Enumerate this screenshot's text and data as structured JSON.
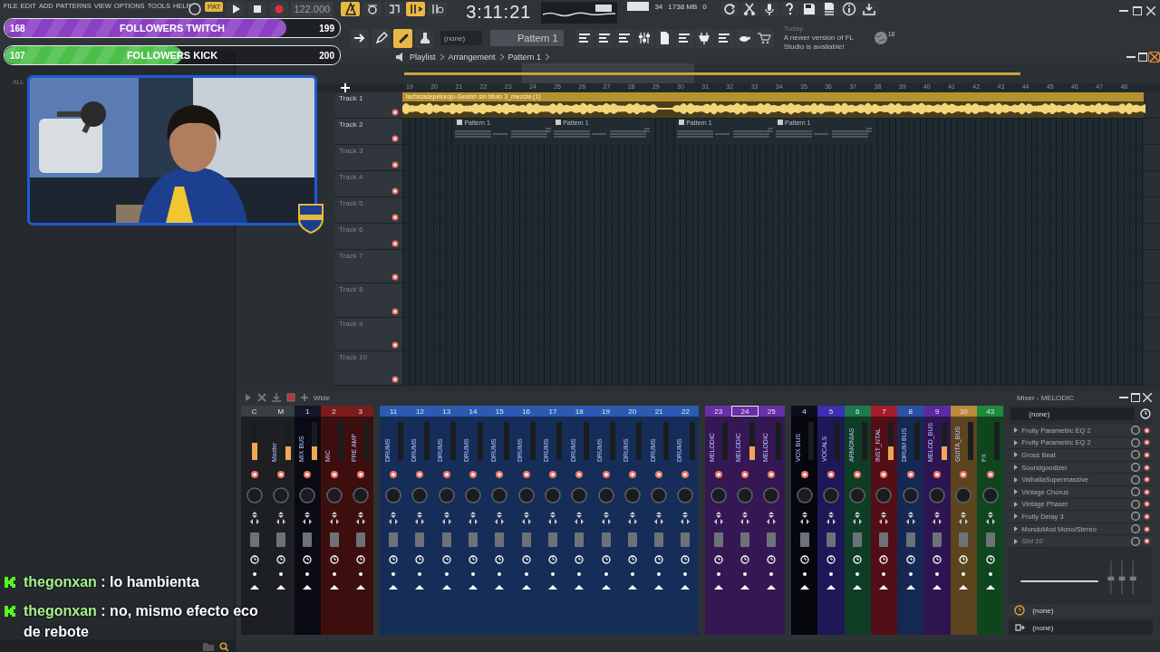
{
  "menu": [
    "FILE",
    "EDIT",
    "ADD",
    "PATTERNS",
    "VIEW",
    "OPTIONS",
    "TOOLS",
    "HELP"
  ],
  "transport": {
    "mode": "PAT",
    "tempo": "122.000",
    "time": "3:11:21",
    "cpu": "34",
    "memory": "1738 MB",
    "polyphony": "0"
  },
  "pattern": {
    "channel": "(none)",
    "name": "Pattern 1"
  },
  "news": {
    "date": "Today",
    "message": "A newer version of FL Studio is available!",
    "count": "18"
  },
  "followers": [
    {
      "count": "168",
      "label": "FOLLOWERS TWITCH",
      "goal": "199",
      "level": 0.84,
      "color": "#8a3fc4"
    },
    {
      "count": "107",
      "label": "FOLLOWERS KICK",
      "goal": "200",
      "level": 0.53,
      "color": "#4cbf4a"
    }
  ],
  "browser": {
    "tabs": [
      "ALL"
    ]
  },
  "playlist": {
    "breadcrumb": [
      "Playlist",
      "Arrangement",
      "Pattern 1"
    ],
    "ruler": [
      "19",
      "20",
      "21",
      "22",
      "23",
      "24",
      "25",
      "26",
      "27",
      "28",
      "29",
      "30",
      "31",
      "32",
      "33",
      "34",
      "35",
      "36",
      "37",
      "38",
      "39",
      "40",
      "41",
      "42",
      "43",
      "44",
      "45",
      "46",
      "47",
      "48"
    ],
    "tracks": [
      {
        "name": "Track 1",
        "empty": false,
        "clips": [
          {
            "kind": "audio",
            "title": "lachicadepelorojo-Sesión sin título 3_mezcla (1)"
          }
        ]
      },
      {
        "name": "Track 2",
        "empty": false,
        "clips": [
          {
            "kind": "pattern",
            "title": "Pattern 1"
          },
          {
            "kind": "pattern",
            "title": "Pattern 1"
          },
          {
            "kind": "pattern",
            "title": "Pattern 1"
          },
          {
            "kind": "pattern",
            "title": "Pattern 1"
          }
        ]
      },
      {
        "name": "Track 3",
        "empty": true
      },
      {
        "name": "Track 4",
        "empty": true
      },
      {
        "name": "Track 5",
        "empty": true
      },
      {
        "name": "Track 6",
        "empty": true
      },
      {
        "name": "Track 7",
        "empty": true
      },
      {
        "name": "Track 8",
        "empty": true
      },
      {
        "name": "Track 9",
        "empty": true
      },
      {
        "name": "Track 10",
        "empty": true
      }
    ]
  },
  "mixer": {
    "toolbar_label": "Wide",
    "strips": [
      {
        "number": "C",
        "color": "#3a3f45",
        "level": 0.45,
        "selected": false
      },
      {
        "number": "M",
        "name": "Master",
        "color": "#3a3f45",
        "level": 0.35,
        "selected": false
      },
      {
        "number": "1",
        "name": "MIX BUS",
        "color": "#15152a",
        "level": 0.35,
        "selected": false
      },
      {
        "number": "2",
        "name": "MIC",
        "color": "#7a1c1c",
        "level": 0,
        "selected": false
      },
      {
        "number": "3",
        "name": "PRE AMP",
        "color": "#7a1c1c",
        "level": 0,
        "selected": false
      },
      {
        "number": "11",
        "name": "DRUMS",
        "color": "#2a5bb0",
        "level": 0,
        "selected": false
      },
      {
        "number": "12",
        "name": "DRUMS",
        "color": "#2a5bb0",
        "level": 0,
        "selected": false
      },
      {
        "number": "13",
        "name": "DRUMS",
        "color": "#2a5bb0",
        "level": 0,
        "selected": false
      },
      {
        "number": "14",
        "name": "DRUMS",
        "color": "#2a5bb0",
        "level": 0,
        "selected": false
      },
      {
        "number": "15",
        "name": "DRUMS",
        "color": "#2a5bb0",
        "level": 0,
        "selected": false
      },
      {
        "number": "16",
        "name": "DRUMS",
        "color": "#2a5bb0",
        "level": 0,
        "selected": false
      },
      {
        "number": "17",
        "name": "DRUMS",
        "color": "#2a5bb0",
        "level": 0,
        "selected": false
      },
      {
        "number": "18",
        "name": "DRUMS",
        "color": "#2a5bb0",
        "level": 0,
        "selected": false
      },
      {
        "number": "19",
        "name": "DRUMS",
        "color": "#2a5bb0",
        "level": 0,
        "selected": false
      },
      {
        "number": "20",
        "name": "DRUMS",
        "color": "#2a5bb0",
        "level": 0,
        "selected": false
      },
      {
        "number": "21",
        "name": "DRUMS",
        "color": "#2a5bb0",
        "level": 0,
        "selected": false
      },
      {
        "number": "22",
        "name": "DRUMS",
        "color": "#2a5bb0",
        "level": 0,
        "selected": false
      },
      {
        "number": "23",
        "name": "MELODIC",
        "color": "#6a2ea6",
        "level": 0,
        "selected": false
      },
      {
        "number": "24",
        "name": "MELODIC",
        "color": "#6a2ea6",
        "level": 0.35,
        "selected": true
      },
      {
        "number": "25",
        "name": "MELODIC",
        "color": "#6a2ea6",
        "level": 0,
        "selected": false
      },
      {
        "number": "4",
        "name": "VOX BUS",
        "color": "#0d0d1c",
        "level": 0,
        "selected": false
      },
      {
        "number": "5",
        "name": "VOCALS",
        "color": "#3b2fb0",
        "level": 0,
        "selected": false
      },
      {
        "number": "6",
        "name": "ARMONIAS",
        "color": "#1d7a4c",
        "level": 0,
        "selected": false
      },
      {
        "number": "7",
        "name": "INST_NTAL",
        "color": "#a51d2d",
        "level": 0.35,
        "selected": false
      },
      {
        "number": "8",
        "name": "DRUM BUS",
        "color": "#2b50a6",
        "level": 0,
        "selected": false
      },
      {
        "number": "9",
        "name": "MELOD_BUS",
        "color": "#5b2aa3",
        "level": 0.35,
        "selected": false
      },
      {
        "number": "10",
        "name": "GUITA_BUS",
        "color": "#b98b3c",
        "level": 0,
        "selected": false
      },
      {
        "number": "43",
        "name": "FX",
        "color": "#1f8a3c",
        "level": 0,
        "selected": false
      }
    ],
    "panel": {
      "title": "Mixer - MELODIC",
      "input": "(none)",
      "slots": [
        {
          "name": "Fruity Parametric EQ 2",
          "empty": false
        },
        {
          "name": "Fruity Parametric EQ 2",
          "empty": false
        },
        {
          "name": "Gross Beat",
          "empty": false
        },
        {
          "name": "Soundgoodizer",
          "empty": false
        },
        {
          "name": "ValhallaSupermassive",
          "empty": false
        },
        {
          "name": "Vintage Chorus",
          "empty": false
        },
        {
          "name": "Vintage Phaser",
          "empty": false
        },
        {
          "name": "Fruity Delay 3",
          "empty": false
        },
        {
          "name": "MondoMod Mono/Stereo",
          "empty": false
        },
        {
          "name": "Slot 10",
          "empty": true
        }
      ],
      "send": "(none)",
      "output": "(none)"
    }
  },
  "chat": [
    {
      "user": "thegonxan",
      "text": ": lo hambienta"
    },
    {
      "user": "thegonxan",
      "text": ": no, mismo efecto eco de rebote"
    }
  ]
}
